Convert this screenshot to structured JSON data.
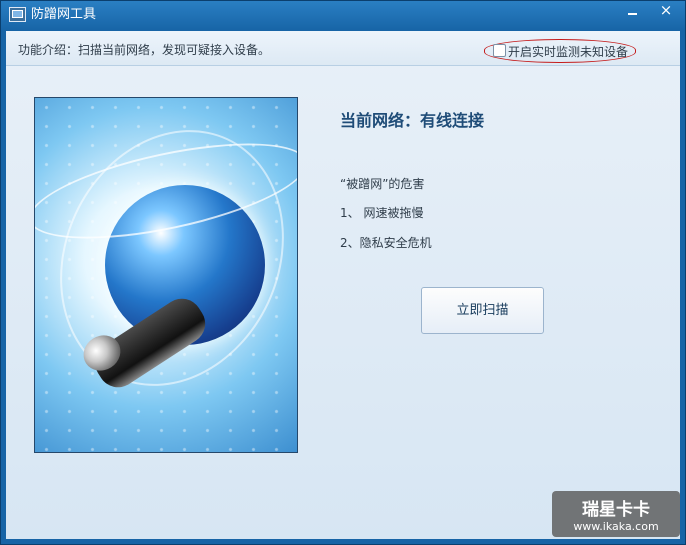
{
  "window": {
    "title": "防蹭网工具",
    "minimize_icon": "minimize-icon",
    "close_icon": "close-icon",
    "close_glyph": "×"
  },
  "header": {
    "intro": "功能介绍：扫描当前网络，发现可疑接入设备。",
    "monitor_checkbox_label": "开启实时监测未知设备",
    "monitor_enabled": false
  },
  "main": {
    "network_status": "当前网络：有线连接",
    "risks_title": "“被蹭网”的危害",
    "risks": [
      "1、 网速被拖慢",
      "2、隐私安全危机"
    ],
    "scan_button": "立即扫描"
  },
  "watermark": {
    "cn": "瑞星卡卡",
    "en": "www.ikaka.com"
  },
  "colors": {
    "titlebar": "#1764a6",
    "content_background": "#dce9f5",
    "heading": "#1f4c78",
    "highlight_outline": "#c51c1c"
  }
}
